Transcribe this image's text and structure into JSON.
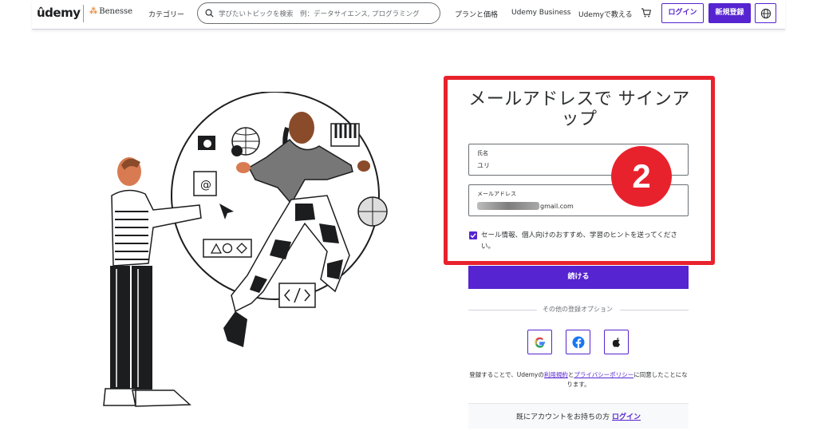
{
  "header": {
    "logo": "ûdemy",
    "partner_logo": "Benesse",
    "categories": "カテゴリー",
    "search_placeholder": "学びたいトピックを検索　例：データサイエンス, プログラミング",
    "plans": "プランと価格",
    "business": "Udemy Business",
    "teach": "Udemyで教える",
    "login_button": "ログイン",
    "signup_button": "新規登録",
    "icons": [
      "search-icon",
      "cart-icon",
      "globe-icon"
    ]
  },
  "form": {
    "title": "メールアドレスで サインアップ",
    "name_label": "氏名",
    "name_value": "ユリ",
    "email_label": "メールアドレス",
    "email_value": "gmail.com",
    "checkbox_checked": true,
    "checkbox_label": "セール情報、個人向けのおすすめ、学習のヒントを送ってください。",
    "continue_button": "続ける",
    "other_options": "その他の登録オプション",
    "social": [
      "google-icon",
      "facebook-icon",
      "apple-icon"
    ],
    "terms_prefix": "登録することで、Udemyの",
    "terms_link": "利用規約",
    "terms_and": "と",
    "privacy_link": "プライバシーポリシー",
    "terms_suffix": "に同意したことになります。",
    "existing_account": "既にアカウントをお持ちの方",
    "login_link": "ログイン"
  },
  "annotation": {
    "step_number": "2",
    "highlight_color": "#e8222d"
  },
  "colors": {
    "accent": "#5624d0",
    "text": "#2d2f31",
    "annotation": "#e8222d"
  }
}
